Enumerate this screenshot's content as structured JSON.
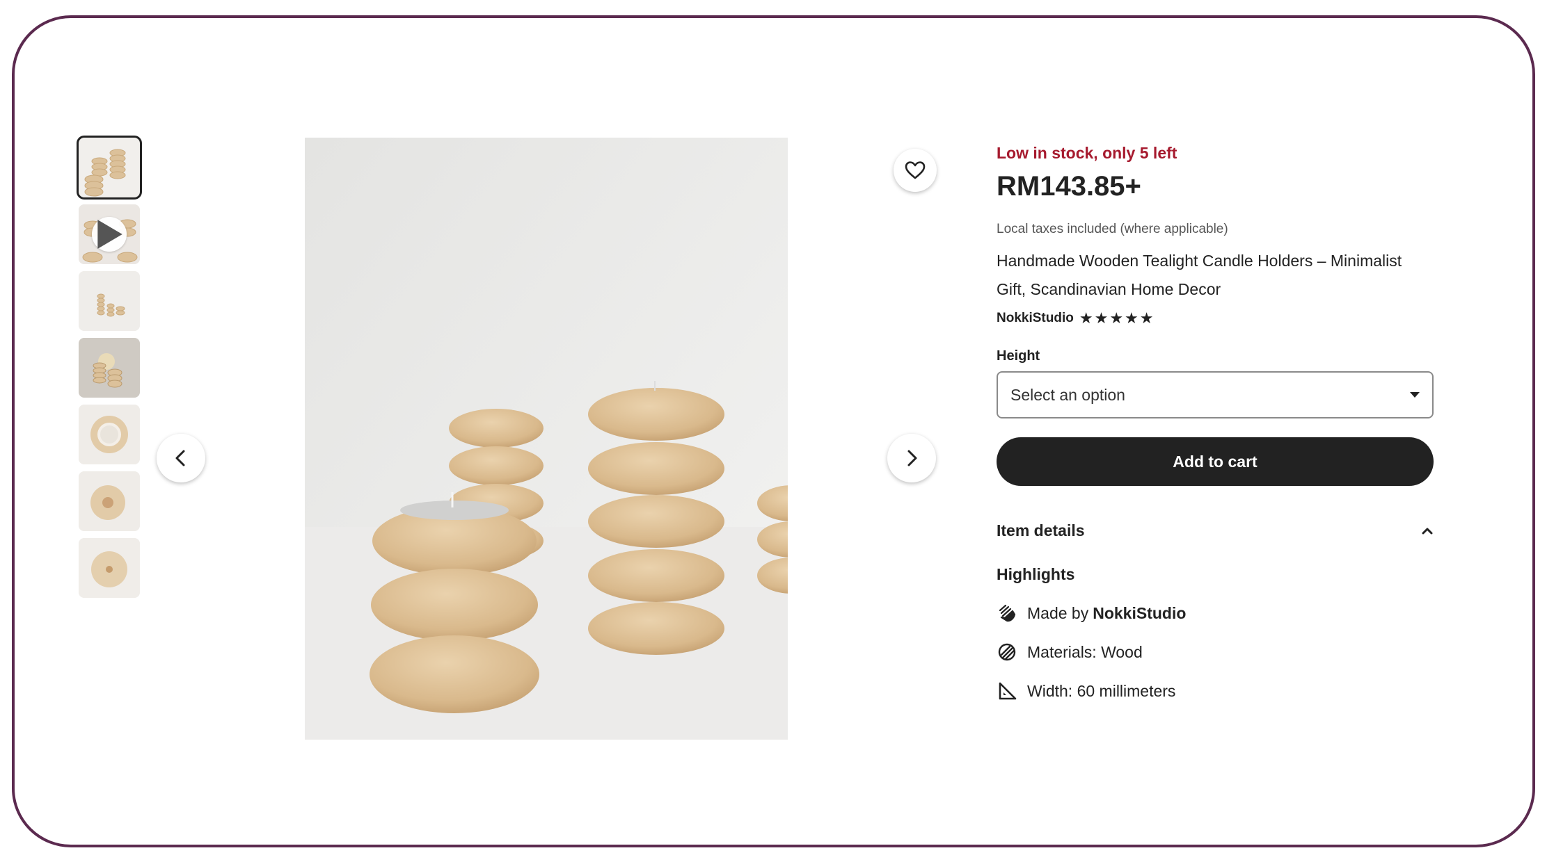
{
  "gallery": {
    "thumbnails": [
      {
        "name": "thumb-stacked-holders",
        "has_video": false
      },
      {
        "name": "thumb-video",
        "has_video": true
      },
      {
        "name": "thumb-small-stacks",
        "has_video": false
      },
      {
        "name": "thumb-lit-candles",
        "has_video": false
      },
      {
        "name": "thumb-top-view-1",
        "has_video": false
      },
      {
        "name": "thumb-top-view-2",
        "has_video": false
      },
      {
        "name": "thumb-top-view-3",
        "has_video": false
      }
    ],
    "icons": {
      "prev": "chevron-left-icon",
      "next": "chevron-right-icon",
      "favorite": "heart-icon",
      "play": "play-icon"
    }
  },
  "product": {
    "stock_notice": "Low in stock, only 5 left",
    "price": "RM143.85+",
    "tax_note": "Local taxes included (where applicable)",
    "title": "Handmade Wooden Tealight Candle Holders – Minimalist Gift, Scandinavian Home Decor",
    "shop_name": "NokkiStudio",
    "rating_stars": 5
  },
  "options": {
    "height_label": "Height",
    "height_placeholder": "Select an option"
  },
  "actions": {
    "add_to_cart": "Add to cart"
  },
  "details": {
    "section_title": "Item details",
    "highlights_title": "Highlights",
    "made_by_prefix": "Made by",
    "made_by_shop": "NokkiStudio",
    "materials": "Materials: Wood",
    "width": "Width: 60 millimeters"
  },
  "colors": {
    "stock_red": "#a61a2e",
    "frame_border": "#5b2a4f",
    "button_dark": "#222222"
  }
}
